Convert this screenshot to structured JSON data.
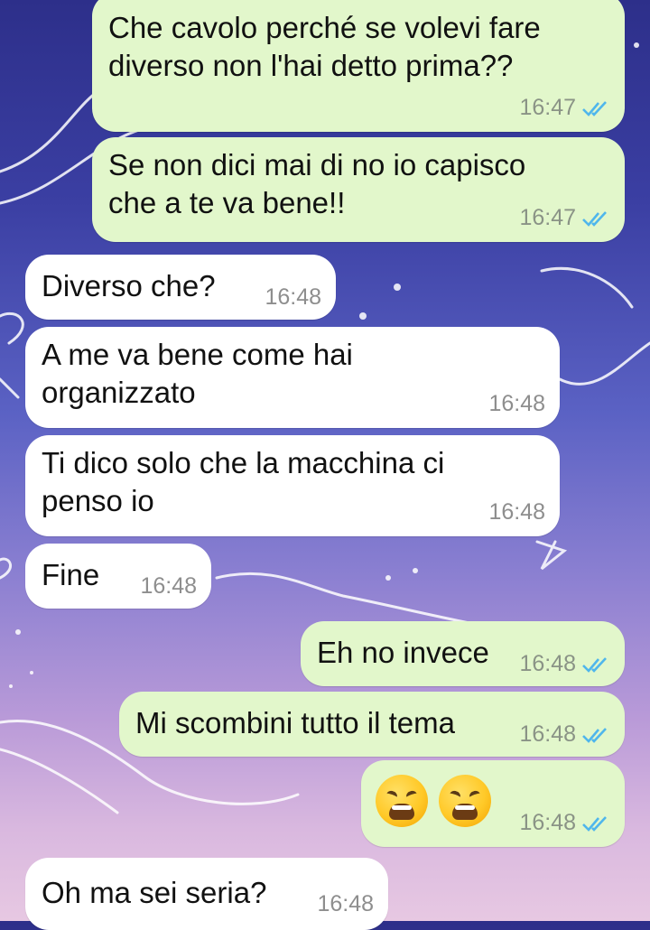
{
  "chat": {
    "messages": [
      {
        "dir": "out",
        "text": "Che cavolo perché se volevi fare\ndiverso non l'hai detto prima??",
        "time": "16:47",
        "status": "read"
      },
      {
        "dir": "out",
        "text": "Se non dici mai di no io capisco\nche a te va bene!!",
        "time": "16:47",
        "status": "read"
      },
      {
        "dir": "in",
        "text": "Diverso che?",
        "time": "16:48"
      },
      {
        "dir": "in",
        "text": "A me va bene come hai\norganizzato",
        "time": "16:48"
      },
      {
        "dir": "in",
        "text": "Ti dico solo che la macchina ci\npenso io",
        "time": "16:48"
      },
      {
        "dir": "in",
        "text": "Fine",
        "time": "16:48"
      },
      {
        "dir": "out",
        "text": "Eh no invece",
        "time": "16:48",
        "status": "read"
      },
      {
        "dir": "out",
        "text": "Mi scombini tutto il tema",
        "time": "16:48",
        "status": "read"
      },
      {
        "dir": "out",
        "text": "😩😩",
        "emoji_name": "weary-face",
        "time": "16:48",
        "status": "read"
      },
      {
        "dir": "in",
        "text": "Oh ma sei seria?",
        "time": "16:48"
      }
    ]
  },
  "colors": {
    "outgoing_bubble": "#e2f7cb",
    "incoming_bubble": "#ffffff",
    "read_tick": "#4fb6ec",
    "timestamp": "#8a9386"
  },
  "icons": {
    "read_receipt": "double-check-icon",
    "emoji": "weary-face-emoji"
  }
}
